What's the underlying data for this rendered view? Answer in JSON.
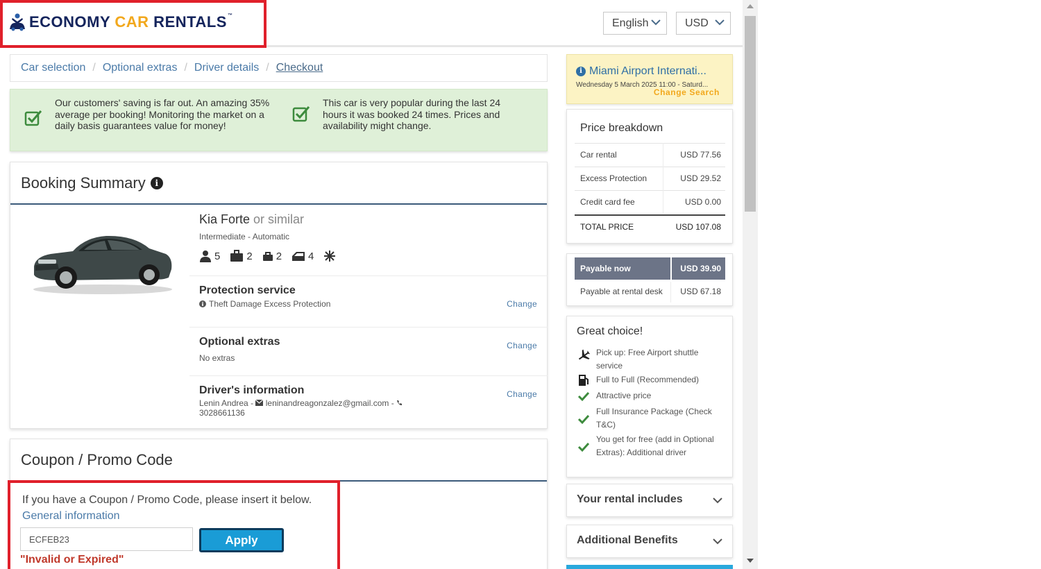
{
  "header": {
    "brand_part1": "ECONOMY ",
    "brand_part2": "CAR",
    "brand_part3": " RENTALS",
    "trademark": "™",
    "language": "English",
    "currency": "USD"
  },
  "breadcrumb": [
    {
      "label": "Car selection"
    },
    {
      "label": "Optional extras"
    },
    {
      "label": "Driver details"
    },
    {
      "label": "Checkout",
      "active": true
    }
  ],
  "breadcrumb_sep": "/",
  "banner": {
    "msg1": "Our customers' saving is far out. An amazing 35% average per booking! Monitoring the market on a daily basis guarantees value for money!",
    "msg2": "This car is very popular during the last 24 hours it was booked 24 times. Prices and availability might change."
  },
  "summary": {
    "title": "Booking Summary",
    "info_glyph": "i",
    "car_name": "Kia Forte",
    "car_similar": " or similar",
    "car_class": "Intermediate - Automatic",
    "features": {
      "seats": "5",
      "large_bags": "2",
      "small_bags": "2",
      "doors": "4"
    },
    "protection_title": "Protection service",
    "protection_sub": "Theft Damage Excess Protection",
    "extras_title": "Optional extras",
    "extras_sub": "No extras",
    "driver_title": "Driver's information",
    "driver_name": "Lenin Andrea - ",
    "driver_email": "leninandreagonzalez@gmail.com",
    "driver_dash": " - ",
    "driver_phone": "3028661136",
    "change_label": "Change"
  },
  "coupon": {
    "title": "Coupon / Promo Code",
    "instruction": "If you have a Coupon / Promo Code, please insert it below.",
    "link": "General information",
    "code_value": "ECFEB23",
    "apply_label": "Apply",
    "error": "\"Invalid or Expired\""
  },
  "location": {
    "info_glyph": "i",
    "name": "Miami Airport Internati...",
    "dates": "Wednesday 5 March 2025 11:00 - Saturd...",
    "change_search": "Change Search"
  },
  "price_breakdown": {
    "title": "Price breakdown",
    "rows": [
      {
        "label": "Car rental",
        "value": "USD 77.56"
      },
      {
        "label": "Excess Protection",
        "value": "USD 29.52"
      },
      {
        "label": "Credit card fee",
        "value": "USD 0.00"
      }
    ],
    "total_label": "TOTAL PRICE",
    "total_value": "USD 107.08"
  },
  "payment": {
    "now_label": "Payable now",
    "now_value": "USD 39.90",
    "desk_label": "Payable at rental desk",
    "desk_value": "USD 67.18"
  },
  "great_choice": {
    "title": "Great choice!",
    "items": [
      {
        "icon": "plane-icon",
        "text": "Pick up: Free Airport shuttle service"
      },
      {
        "icon": "fuel-icon",
        "text": "Full to Full (Recommended)"
      },
      {
        "icon": "check-icon",
        "text": "Attractive price"
      },
      {
        "icon": "check-icon",
        "text": "Full Insurance Package (Check T&C)"
      },
      {
        "icon": "check-icon",
        "text": "You get for free (add in Optional Extras): Additional driver"
      }
    ]
  },
  "accordions": {
    "rental_includes": "Your rental includes",
    "additional_benefits": "Additional Benefits"
  },
  "colors": {
    "brand_navy": "#14245c",
    "brand_gold": "#f2a81d",
    "link_blue": "#4a7aa8",
    "banner_green": "#dff0d8",
    "apply_blue": "#1a9cd6",
    "error_red": "#c0392b",
    "highlight_red": "#e0202b"
  }
}
